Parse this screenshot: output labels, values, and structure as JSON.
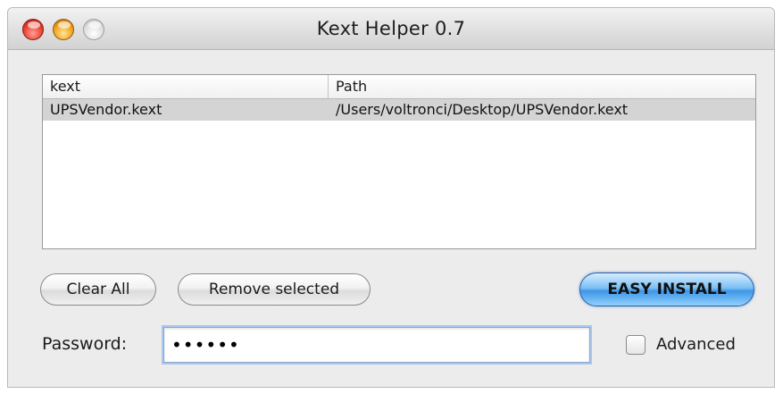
{
  "window": {
    "title": "Kext Helper 0.7"
  },
  "table": {
    "columns": [
      "kext",
      "Path"
    ],
    "rows": [
      {
        "kext": "UPSVendor.kext",
        "path": "/Users/voltronci/Desktop/UPSVendor.kext",
        "selected": true
      }
    ]
  },
  "buttons": {
    "clear_all": "Clear All",
    "remove_selected": "Remove selected",
    "easy_install": "EASY INSTALL"
  },
  "password": {
    "label": "Password:",
    "value": "••••••"
  },
  "advanced": {
    "label": "Advanced",
    "checked": false
  },
  "colors": {
    "selection": "#d4d4d4",
    "default_button": "#3f96e6",
    "focus_ring": "#a9c6ee"
  },
  "icons": [
    "close-button-icon",
    "minimize-button-icon",
    "zoom-button-icon"
  ]
}
